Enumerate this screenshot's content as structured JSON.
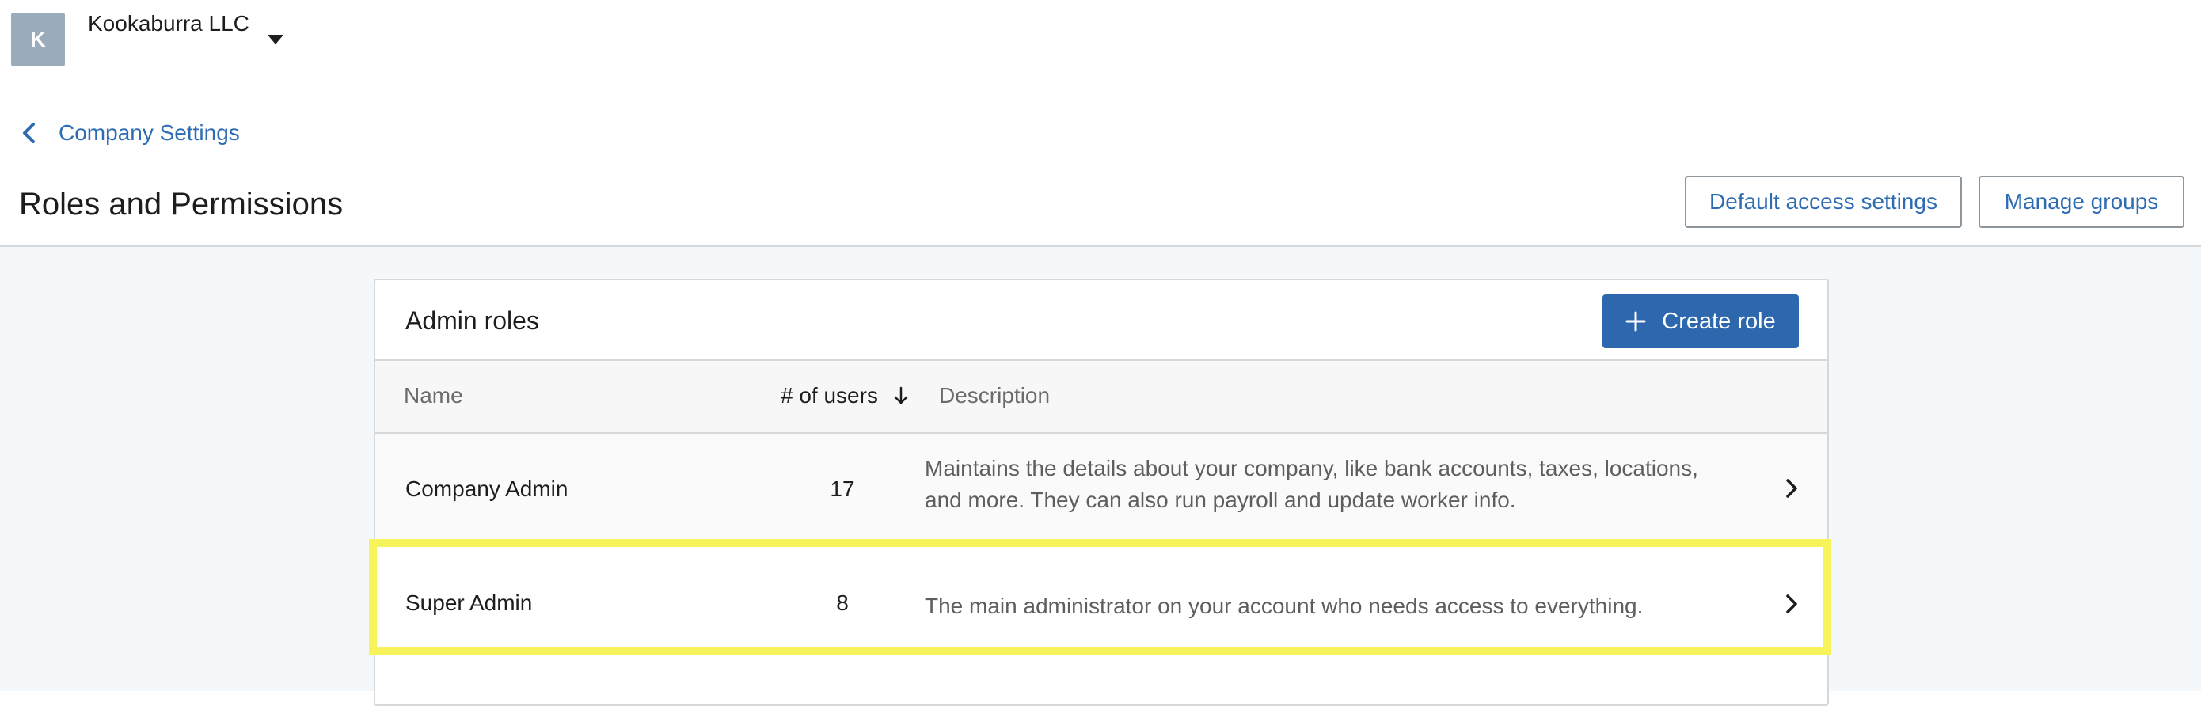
{
  "header": {
    "avatar_initial": "K",
    "company_name": "Kookaburra LLC",
    "back_link_label": "Company Settings",
    "page_title": "Roles and Permissions",
    "default_access_button": "Default access settings",
    "manage_groups_button": "Manage groups"
  },
  "card": {
    "title": "Admin roles",
    "create_button_label": "Create role",
    "columns": {
      "name": "Name",
      "users": "# of users",
      "description": "Description"
    },
    "rows": [
      {
        "name": "Company Admin",
        "users": "17",
        "description": "Maintains the details about your company, like bank accounts, taxes, locations, and more. They can also run payroll and update worker info."
      },
      {
        "name": "Super Admin",
        "users": "8",
        "description": "The main administrator on your account who needs access to everything."
      }
    ]
  },
  "icons": {
    "company_switcher": "caret-down-icon",
    "back": "chevron-left-icon",
    "create": "plus-icon",
    "sort": "arrow-down-icon",
    "row_open": "chevron-right-icon"
  },
  "colors": {
    "link": "#2d6bb3",
    "primary_button": "#2d67ad",
    "avatar": "#9aabbb",
    "main_background": "#f5f8fa",
    "highlight": "#f7f35a"
  }
}
